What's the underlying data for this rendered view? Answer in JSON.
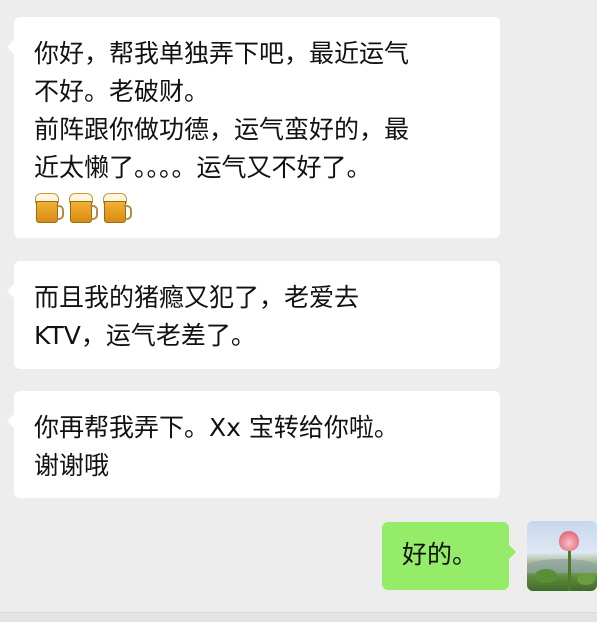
{
  "messages": [
    {
      "side": "left",
      "lines": [
        "你好，帮我单独弄下吧，最近运气",
        "不好。老破财。",
        "前阵跟你做功德，运气蛮好的，最",
        "近太懒了。。。。运气又不好了。"
      ],
      "emoji": [
        "beer-mug-icon",
        "beer-mug-icon",
        "beer-mug-icon"
      ]
    },
    {
      "side": "left",
      "lines": [
        "而且我的猪瘾又犯了，老爱去",
        "KTV，运气老差了。"
      ]
    },
    {
      "side": "left",
      "lines": [
        "你再帮我弄下。Xx 宝转给你啦。",
        "谢谢哦"
      ]
    },
    {
      "side": "right",
      "lines": [
        "好的。"
      ],
      "avatar": "lotus-flower-avatar"
    }
  ],
  "colors": {
    "background": "#ededed",
    "incoming_bubble": "#ffffff",
    "outgoing_bubble": "#95ec69"
  }
}
